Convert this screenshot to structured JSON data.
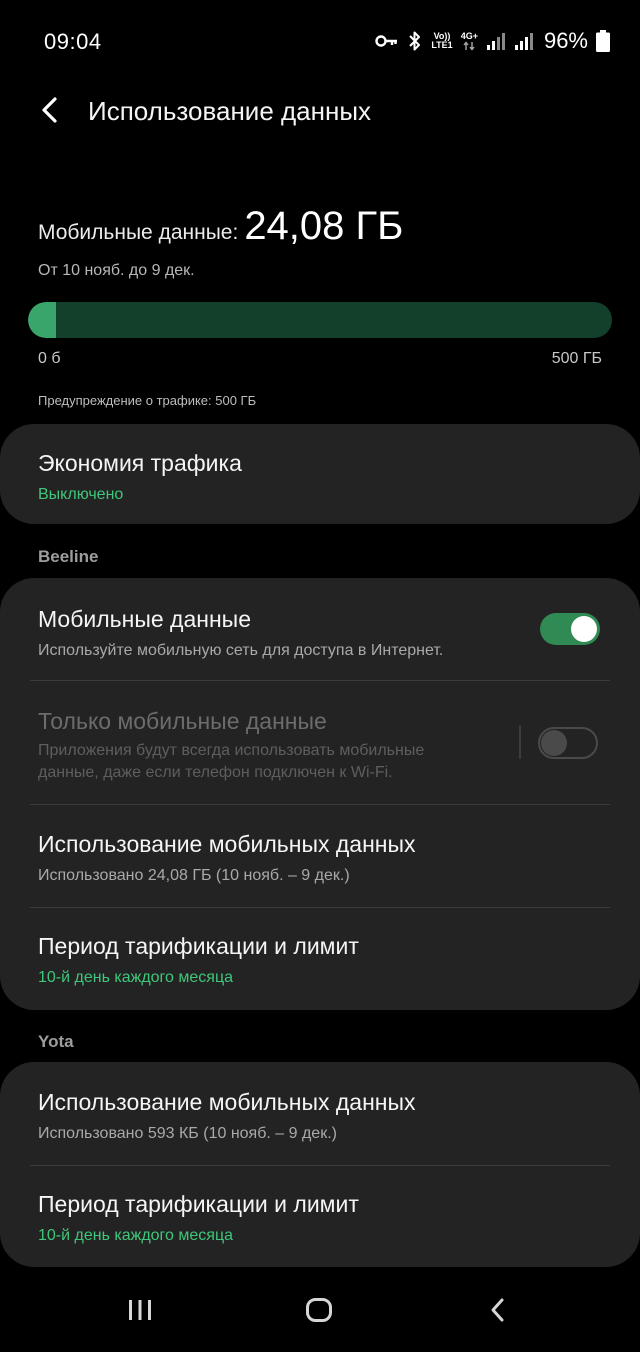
{
  "status_bar": {
    "time": "09:04",
    "net_top": "Vo))",
    "net_bottom": "LTE1",
    "net_gen": "4G+",
    "battery": "96%",
    "icons": [
      "key-icon",
      "bluetooth-icon",
      "signal-icon",
      "battery-icon"
    ]
  },
  "header": {
    "title": "Использование данных",
    "back_icon": "back-arrow-icon"
  },
  "usage": {
    "label": "Мобильные данные:",
    "value": "24,08 ГБ",
    "period": "От 10 нояб. до 9 дек.",
    "progress_fraction": 0.04816,
    "scale_min": "0 б",
    "scale_max": "500 ГБ",
    "warning": "Предупреждение о трафике: 500 ГБ"
  },
  "data_saver": {
    "title": "Экономия трафика",
    "status": "Выключено"
  },
  "beeline": {
    "label": "Beeline",
    "mobile_data": {
      "title": "Мобильные данные",
      "subtitle": "Используйте мобильную сеть для доступа в Интернет.",
      "enabled": true
    },
    "mobile_only": {
      "title": "Только мобильные данные",
      "subtitle_line1": "Приложения будут всегда использовать мобильные",
      "subtitle_line2": "данные, даже если телефон подключен к Wi-Fi.",
      "enabled": false
    },
    "usage": {
      "title": "Использование мобильных данных",
      "subtitle": "Использовано 24,08 ГБ (10 нояб. – 9 дек.)"
    },
    "billing": {
      "title": "Период тарификации и лимит",
      "subtitle": "10-й день каждого месяца"
    }
  },
  "yota": {
    "label": "Yota",
    "usage": {
      "title": "Использование мобильных данных",
      "subtitle": "Использовано 593 КБ (10 нояб. – 9 дек.)"
    },
    "billing": {
      "title": "Период тарификации и лимит",
      "subtitle": "10-й день каждого месяца"
    }
  },
  "nav_bar": {
    "icons": [
      "recents-icon",
      "home-icon",
      "back-icon"
    ]
  },
  "colors": {
    "accent_green": "#3ec77a",
    "toggle_on": "#2f8a53",
    "progress_track": "#13402a",
    "progress_fill": "#3aa56a",
    "card_bg": "#232323"
  }
}
